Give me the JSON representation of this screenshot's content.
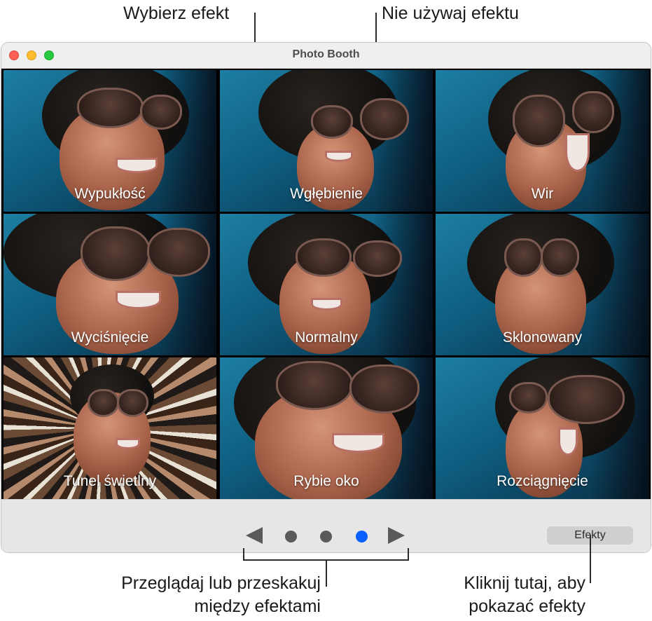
{
  "window": {
    "title": "Photo Booth"
  },
  "callouts": {
    "choose_effect": "Wybierz efekt",
    "no_effect": "Nie używaj efektu",
    "browse": "Przeglądaj lub przeskakuj\nmiędzy efektami",
    "click_here": "Kliknij tutaj, aby\npokazać efekty"
  },
  "effects": [
    "Wypukłość",
    "Wgłębienie",
    "Wir",
    "Wyciśnięcie",
    "Normalny",
    "Sklonowany",
    "Tunel świetlny",
    "Rybie oko",
    "Rozciągnięcie"
  ],
  "pager": {
    "pages": 3,
    "current_page": 3
  },
  "toolbar": {
    "effects_button": "Efekty"
  },
  "colors": {
    "active_dot": "#0a60ff",
    "inactive_dot": "#5a5a5a"
  }
}
